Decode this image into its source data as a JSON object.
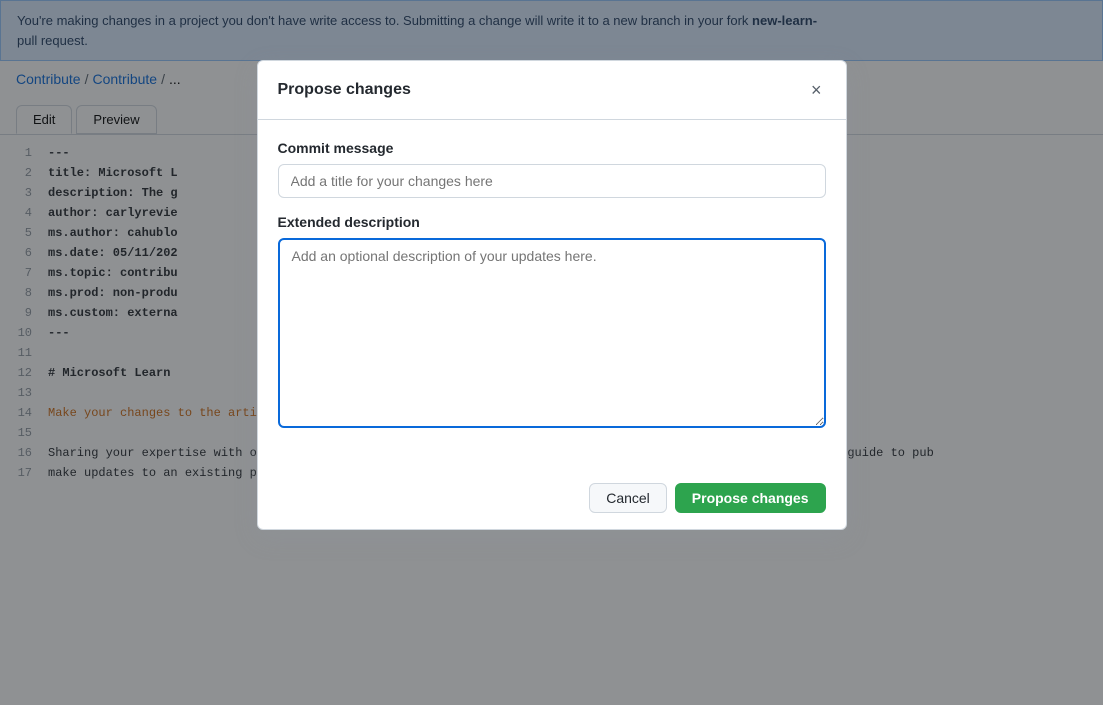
{
  "banner": {
    "text": "You're making changes in a project you don't have write access to. Submitting a change will write it to a new branch in your fork ",
    "bold_text": "new-learn-",
    "text2": "pull request."
  },
  "breadcrumb": {
    "items": [
      "Contribute",
      "Contribute",
      "..."
    ]
  },
  "tabs": {
    "edit_label": "Edit",
    "preview_label": "Preview"
  },
  "code_lines": [
    {
      "num": 1,
      "content": "---",
      "bold": true
    },
    {
      "num": 2,
      "content": "title: Microsoft L",
      "bold": true
    },
    {
      "num": 3,
      "content": "description: The g",
      "bold": true
    },
    {
      "num": 4,
      "content": "author: carlyrevie",
      "bold": true
    },
    {
      "num": 5,
      "content": "ms.author: cahublo",
      "bold": true
    },
    {
      "num": 6,
      "content": "ms.date: 05/11/202",
      "bold": true
    },
    {
      "num": 7,
      "content": "ms.topic: contribu",
      "bold": true
    },
    {
      "num": 8,
      "content": "ms.prod: non-produ",
      "bold": true
    },
    {
      "num": 9,
      "content": "ms.custom: externa",
      "bold": true
    },
    {
      "num": 10,
      "content": "---",
      "bold": true
    },
    {
      "num": 11,
      "content": "",
      "bold": false
    },
    {
      "num": 12,
      "content": "# Microsoft Learn",
      "bold": true
    },
    {
      "num": 13,
      "content": "",
      "bold": false
    },
    {
      "num": 14,
      "content": "Make your changes to the article: Welcome to the Microsoft Learn documentation contributor guide!",
      "bold": false,
      "colored": true
    },
    {
      "num": 15,
      "content": "",
      "bold": false
    },
    {
      "num": 16,
      "content": "Sharing your expertise with others on Microsoft Learn helps everyone achieve more. Use the information in this guide to pub",
      "bold": false
    },
    {
      "num": 17,
      "content": "make updates to an existing published article.",
      "bold": false
    }
  ],
  "modal": {
    "title": "Propose changes",
    "close_label": "×",
    "commit_message_label": "Commit message",
    "commit_message_placeholder": "Add a title for your changes here",
    "extended_description_label": "Extended description",
    "extended_description_placeholder": "Add an optional description of your updates here.",
    "cancel_label": "Cancel",
    "propose_label": "Propose changes"
  }
}
